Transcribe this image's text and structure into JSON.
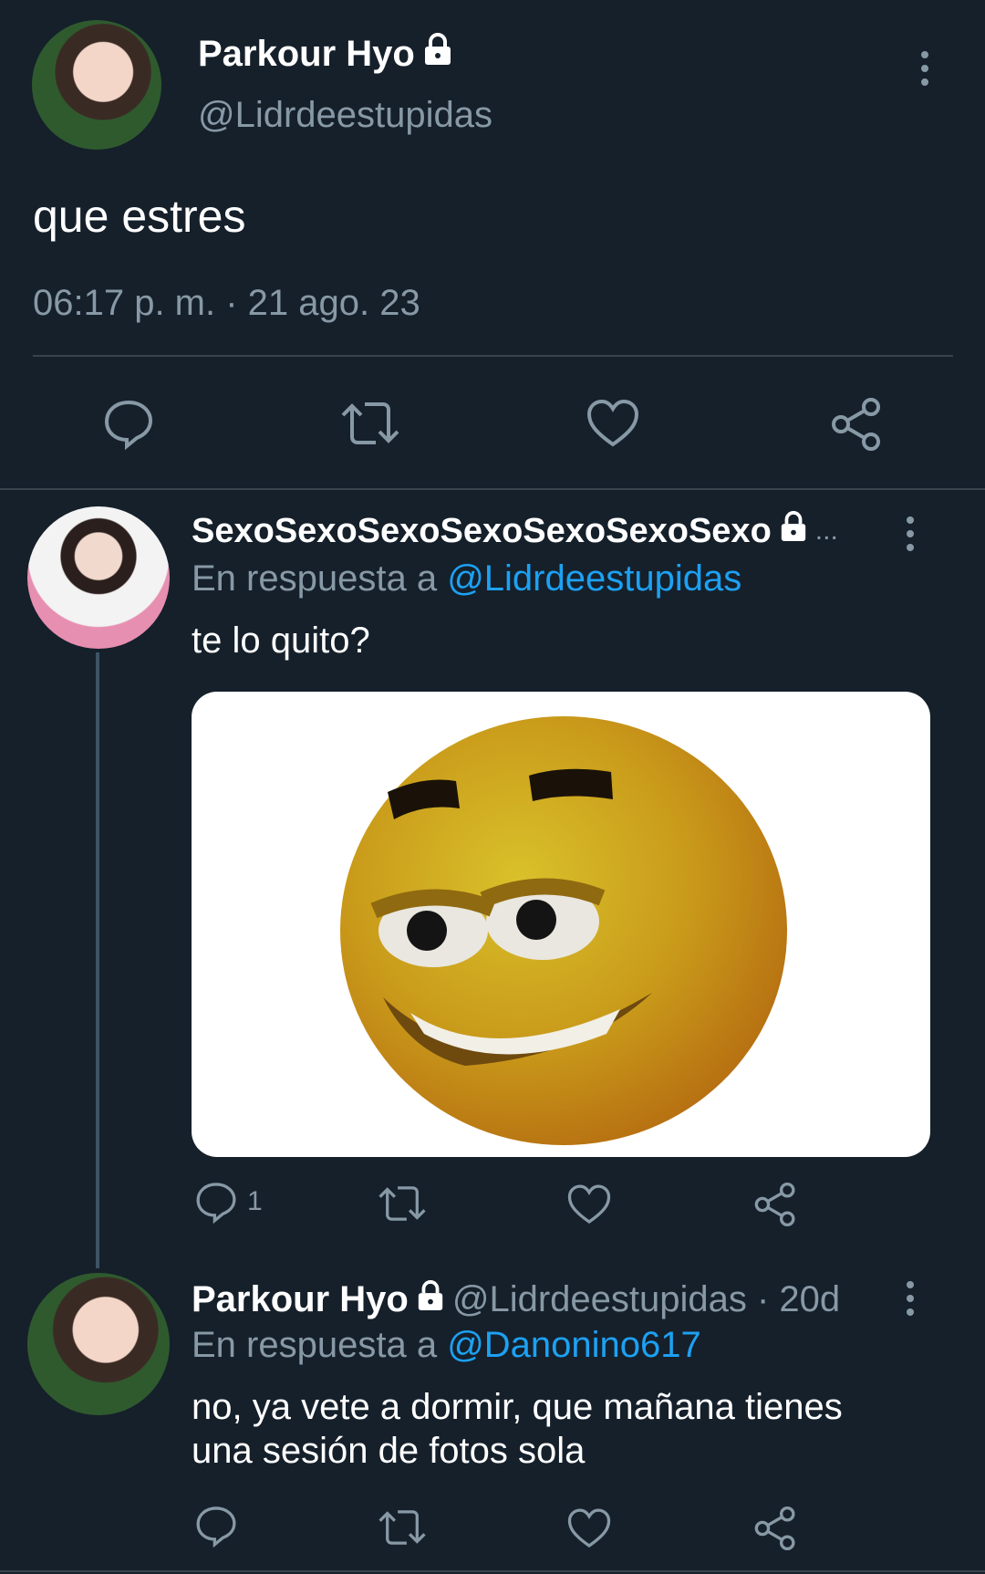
{
  "main_tweet": {
    "display_name": "Parkour Hyo",
    "handle": "@Lidrdeestupidas",
    "text": "que estres",
    "timestamp": "06:17 p. m. · 21 ago. 23"
  },
  "reply1": {
    "display_name": "SexoSexoSexoSexoSexoSexoSexo",
    "ellipsis": "...",
    "reply_prefix": "En respuesta a",
    "reply_to": "@Lidrdeestupidas",
    "text": "te lo quito?",
    "reply_count": "1"
  },
  "reply2": {
    "display_name": "Parkour Hyo",
    "handle_time": "@Lidrdeestupidas · 20d",
    "reply_prefix": "En respuesta a",
    "reply_to": "@Danonino617",
    "text_line1": "no, ya vete a dormir, que mañana tienes",
    "text_line2": "una sesión de fotos sola"
  },
  "icons": [
    "lock-icon",
    "more-options-icon",
    "reply-icon",
    "retweet-icon",
    "like-icon",
    "share-icon"
  ],
  "colors": {
    "background": "#15202b",
    "muted": "#8899a6",
    "link": "#1da1f2",
    "divider": "#38444d"
  }
}
